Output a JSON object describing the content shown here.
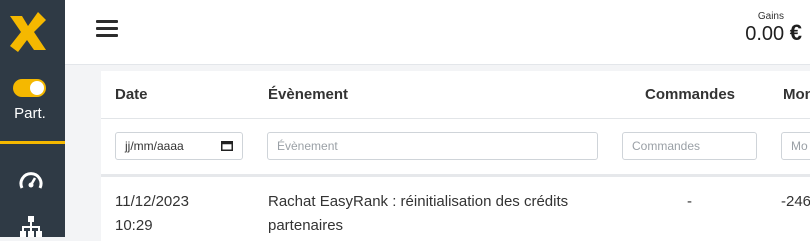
{
  "sidebar": {
    "partner_label": "Part.",
    "brand_color": "#f5b800",
    "background": "#2f3a45",
    "icons": [
      "logo-x-icon",
      "speedometer-icon",
      "sitemap-icon"
    ]
  },
  "header": {
    "gains_label": "Gains",
    "gains_value": "0.00",
    "currency": "€"
  },
  "table": {
    "columns": [
      "Date",
      "Évènement",
      "Commandes",
      "Mon"
    ],
    "filters": {
      "date_value": "jj/mm/aaaa",
      "event_placeholder": "Évènement",
      "orders_placeholder": "Commandes",
      "amount_placeholder": "Mo"
    },
    "rows": [
      {
        "date": "11/12/2023",
        "time": "10:29",
        "event_line1": "Rachat EasyRank : réinitialisation des crédits",
        "event_line2": "partenaires",
        "orders": "-",
        "amount": "-246"
      }
    ]
  }
}
